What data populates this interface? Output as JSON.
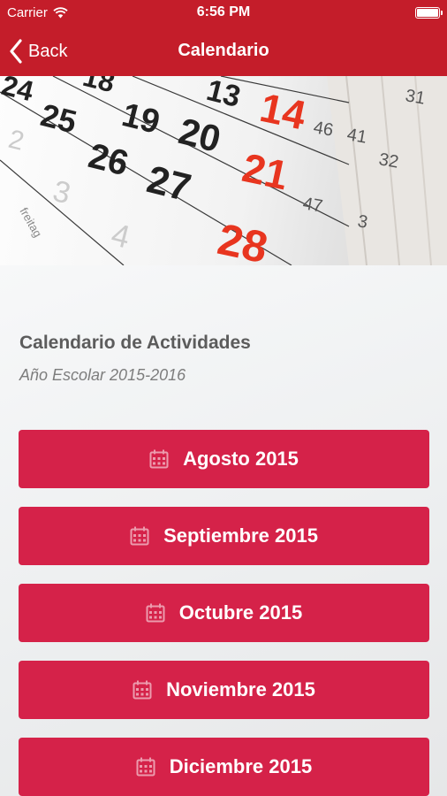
{
  "status_bar": {
    "carrier": "Carrier",
    "time": "6:56 PM"
  },
  "nav": {
    "back_label": "Back",
    "title": "Calendario"
  },
  "hero": {
    "calendar_numbers": [
      "24",
      "18",
      "13",
      "14",
      "31",
      "25",
      "19",
      "20",
      "46",
      "41",
      "32",
      "26",
      "21",
      "27",
      "47",
      "3",
      "28",
      "freitag",
      "2",
      "3",
      "4"
    ]
  },
  "content": {
    "title": "Calendario de Actividades",
    "subtitle": "Año Escolar 2015-2016",
    "months": [
      {
        "label": "Agosto 2015"
      },
      {
        "label": "Septiembre 2015"
      },
      {
        "label": "Octubre 2015"
      },
      {
        "label": "Noviembre 2015"
      },
      {
        "label": "Diciembre 2015"
      }
    ]
  },
  "colors": {
    "nav_red": "#c41d2a",
    "button_red": "#d52249",
    "calendar_red": "#e8351f"
  },
  "icons": {
    "back": "chevron-left-icon",
    "wifi": "wifi-icon",
    "battery": "battery-icon",
    "month": "calendar-icon"
  }
}
